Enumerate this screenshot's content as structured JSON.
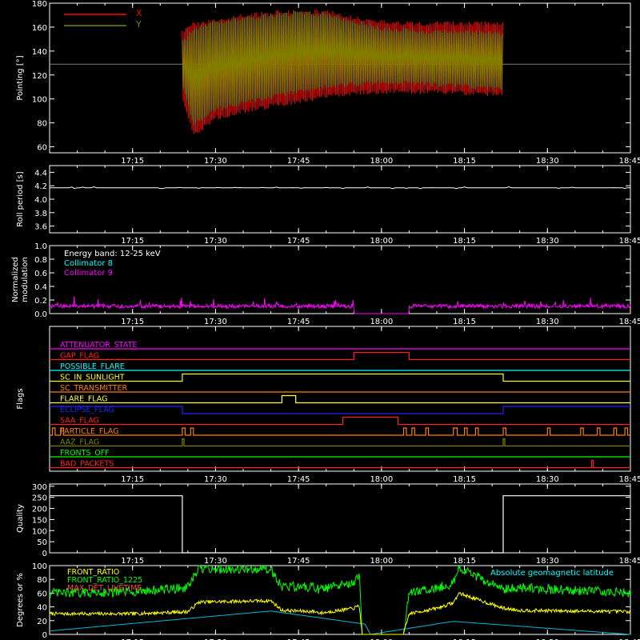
{
  "x_axis": {
    "start": "17:00",
    "end": "18:45",
    "ticks": [
      "17:15",
      "17:30",
      "17:45",
      "18:00",
      "18:15",
      "18:30",
      "18:45"
    ]
  },
  "chart_data": [
    {
      "type": "area",
      "ylabel": "Pointing [°]",
      "ylim": [
        55,
        180
      ],
      "yticks": [
        "180",
        "160",
        "140",
        "120",
        "100",
        "80",
        "60"
      ],
      "legend": [
        "X",
        "Y"
      ],
      "legend_placement": "top-left",
      "reference_line": 129,
      "data_window": [
        "17:24",
        "18:22"
      ],
      "series": [
        {
          "name": "X",
          "color": "#ff0000",
          "x": [
            "17:24",
            "17:26",
            "17:30",
            "17:35",
            "17:40",
            "17:45",
            "17:50",
            "17:55",
            "18:00",
            "18:05",
            "18:10",
            "18:15",
            "18:20",
            "18:22"
          ],
          "max": [
            158,
            164,
            168,
            171,
            174,
            175,
            175,
            170,
            166,
            165,
            165,
            165,
            165,
            165
          ],
          "min": [
            100,
            68,
            82,
            88,
            92,
            96,
            100,
            103,
            104,
            104,
            104,
            103,
            102,
            102
          ]
        },
        {
          "name": "Y",
          "color": "#808000",
          "x": [
            "17:24",
            "17:26",
            "17:30",
            "17:35",
            "17:40",
            "17:45",
            "17:50",
            "17:55",
            "18:00",
            "18:05",
            "18:10",
            "18:15",
            "18:20",
            "18:22"
          ],
          "max": [
            150,
            160,
            166,
            169,
            172,
            174,
            173,
            167,
            161,
            159,
            158,
            158,
            157,
            157
          ],
          "min": [
            110,
            76,
            89,
            95,
            99,
            104,
            108,
            110,
            112,
            111,
            110,
            109,
            107,
            107
          ]
        }
      ]
    },
    {
      "type": "line",
      "ylabel": "Roll period [s]",
      "ylim": [
        3.5,
        4.5
      ],
      "yticks": [
        "4.4",
        "4.2",
        "4.0",
        "3.8",
        "3.6"
      ],
      "series": [
        {
          "color": "#ffffff",
          "x": [
            "17:00",
            "18:45"
          ],
          "y": [
            4.17,
            4.17
          ]
        }
      ]
    },
    {
      "type": "line",
      "ylabel": "Normalized modulation",
      "ylim": [
        0,
        1
      ],
      "yticks": [
        "1.0",
        "0.8",
        "0.6",
        "0.4",
        "0.2",
        "0.0"
      ],
      "annotations": [
        {
          "text": "Energy band: 12-25 keV",
          "color": "#ffffff"
        },
        {
          "text": "Collimator 8",
          "color": "#00ffff"
        },
        {
          "text": "Collimator 9",
          "color": "#ff00ff"
        }
      ],
      "series": [
        {
          "name": "Collimator 9",
          "color": "#ff00ff",
          "x": [
            "17:00",
            "17:55",
            "17:55",
            "18:05",
            "18:05",
            "18:45"
          ],
          "y": [
            0.11,
            0.11,
            0.0,
            0.0,
            0.11,
            0.11
          ]
        }
      ]
    },
    {
      "type": "line",
      "ylabel": "Flags",
      "flags": [
        {
          "label": "ATTENUATOR_STATE",
          "color": "#ff00ff",
          "steps": [
            [
              "17:00",
              0
            ]
          ]
        },
        {
          "label": "GAP_FLAG",
          "color": "#ff2020",
          "steps": [
            [
              "17:00",
              0
            ],
            [
              "17:55",
              1
            ],
            [
              "18:05",
              0
            ]
          ]
        },
        {
          "label": "POSSIBLE_FLARE",
          "color": "#00ffff",
          "steps": [
            [
              "17:00",
              0
            ]
          ]
        },
        {
          "label": "SC_IN_SUNLIGHT",
          "color": "#ffff00",
          "steps": [
            [
              "17:00",
              0
            ],
            [
              "17:24",
              1
            ],
            [
              "18:22",
              0
            ]
          ]
        },
        {
          "label": "SC_TRANSMITTER",
          "color": "#ff8000",
          "steps": [
            [
              "17:00",
              0
            ]
          ]
        },
        {
          "label": "FLARE_FLAG",
          "color": "#ffff40",
          "steps": [
            [
              "17:00",
              0
            ],
            [
              "17:42",
              1
            ],
            [
              "17:44.5",
              0
            ]
          ]
        },
        {
          "label": "ECLIPSE_FLAG",
          "color": "#2020ff",
          "steps": [
            [
              "17:00",
              1
            ],
            [
              "17:24",
              0
            ],
            [
              "18:22",
              1
            ]
          ]
        },
        {
          "label": "SAA_FLAG",
          "color": "#ff2020",
          "steps": [
            [
              "17:00",
              0
            ],
            [
              "17:53",
              1
            ],
            [
              "18:03",
              0
            ]
          ]
        },
        {
          "label": "PARTICLE_FLAG",
          "color": "#ff8000",
          "steps": [
            [
              "17:00",
              0
            ],
            [
              "17:00.5",
              1
            ],
            [
              "17:01",
              0
            ],
            [
              "17:02",
              1
            ],
            [
              "17:02.5",
              0
            ],
            [
              "17:24",
              1
            ],
            [
              "17:24.5",
              0
            ],
            [
              "17:25.5",
              1
            ],
            [
              "17:26",
              0
            ],
            [
              "18:04",
              1
            ],
            [
              "18:04.5",
              0
            ],
            [
              "18:05.5",
              1
            ],
            [
              "18:06",
              0
            ],
            [
              "18:08",
              1
            ],
            [
              "18:08.5",
              0
            ],
            [
              "18:13",
              1
            ],
            [
              "18:13.7",
              0
            ],
            [
              "18:15",
              1
            ],
            [
              "18:15.5",
              0
            ],
            [
              "18:17",
              1
            ],
            [
              "18:17.5",
              0
            ],
            [
              "18:22",
              1
            ],
            [
              "18:22.5",
              0
            ],
            [
              "18:30",
              1
            ],
            [
              "18:30.5",
              0
            ],
            [
              "18:36",
              1
            ],
            [
              "18:36.5",
              0
            ],
            [
              "18:39",
              1
            ],
            [
              "18:39.5",
              0
            ],
            [
              "18:42",
              1
            ],
            [
              "18:42.5",
              0
            ],
            [
              "18:44",
              1
            ],
            [
              "18:44.5",
              0
            ]
          ]
        },
        {
          "label": "AAZ_FLAG",
          "color": "#808000",
          "steps": [
            [
              "17:00",
              0
            ],
            [
              "17:24",
              1
            ],
            [
              "17:24.3",
              0
            ],
            [
              "18:22",
              1
            ],
            [
              "18:22.3",
              0
            ]
          ]
        },
        {
          "label": "FRONTS_OFF",
          "color": "#00ff00",
          "steps": [
            [
              "17:00",
              0
            ]
          ]
        },
        {
          "label": "BAD_PACKETS",
          "color": "#ff2020",
          "steps": [
            [
              "17:00",
              0
            ],
            [
              "18:38",
              1
            ],
            [
              "18:38.3",
              0
            ]
          ]
        }
      ]
    },
    {
      "type": "line",
      "ylabel": "Quality",
      "ylim": [
        0,
        310
      ],
      "yticks": [
        "300",
        "250",
        "200",
        "150",
        "100",
        "50",
        "0"
      ],
      "series": [
        {
          "color": "#ffffff",
          "x": [
            "17:00",
            "17:24",
            "17:24",
            "18:22",
            "18:22",
            "18:45"
          ],
          "y": [
            257,
            257,
            0,
            0,
            257,
            257
          ]
        }
      ]
    },
    {
      "type": "line",
      "ylabel": "Degrees or %",
      "ylim": [
        0,
        100
      ],
      "yticks": [
        "100",
        "80",
        "60",
        "40",
        "20",
        "0"
      ],
      "legend": [
        "FRONT_RATIO",
        "FRONT_RATIO_1225",
        "MAX_DET_LIVETIME"
      ],
      "annotations": [
        {
          "text": "Absolute geomagnetic latitude",
          "color": "#00ffff"
        }
      ],
      "series": [
        {
          "name": "FRONT_RATIO",
          "color": "#ffff00",
          "x": [
            "17:00",
            "17:15",
            "17:25",
            "17:27",
            "17:40",
            "17:42",
            "17:48",
            "17:49",
            "17:55",
            "17:56",
            "17:56.5",
            "18:04",
            "18:05",
            "18:10",
            "18:13",
            "18:14",
            "18:22",
            "18:25",
            "18:45"
          ],
          "y": [
            30,
            30,
            33,
            47,
            49,
            35,
            33,
            31,
            38,
            42,
            0,
            0,
            30,
            38,
            46,
            60,
            38,
            35,
            33
          ]
        },
        {
          "name": "FRONT_RATIO_1225",
          "color": "#00ff00",
          "x": [
            "17:00",
            "17:15",
            "17:25",
            "17:27",
            "17:40",
            "17:42",
            "17:48",
            "17:49",
            "17:55",
            "17:56",
            "17:56.5",
            "18:04",
            "18:05",
            "18:10",
            "18:13",
            "18:14",
            "18:22",
            "18:25",
            "18:45"
          ],
          "y": [
            60,
            62,
            68,
            95,
            95,
            70,
            68,
            65,
            75,
            85,
            0,
            0,
            60,
            68,
            74,
            96,
            66,
            68,
            60
          ]
        },
        {
          "name": "Absolute geomagnetic latitude",
          "color": "#00bcd4",
          "x": [
            "17:00",
            "17:40",
            "17:57",
            "17:58",
            "18:13",
            "18:45"
          ],
          "y": [
            5,
            34,
            15,
            0,
            19,
            0
          ]
        }
      ]
    }
  ]
}
